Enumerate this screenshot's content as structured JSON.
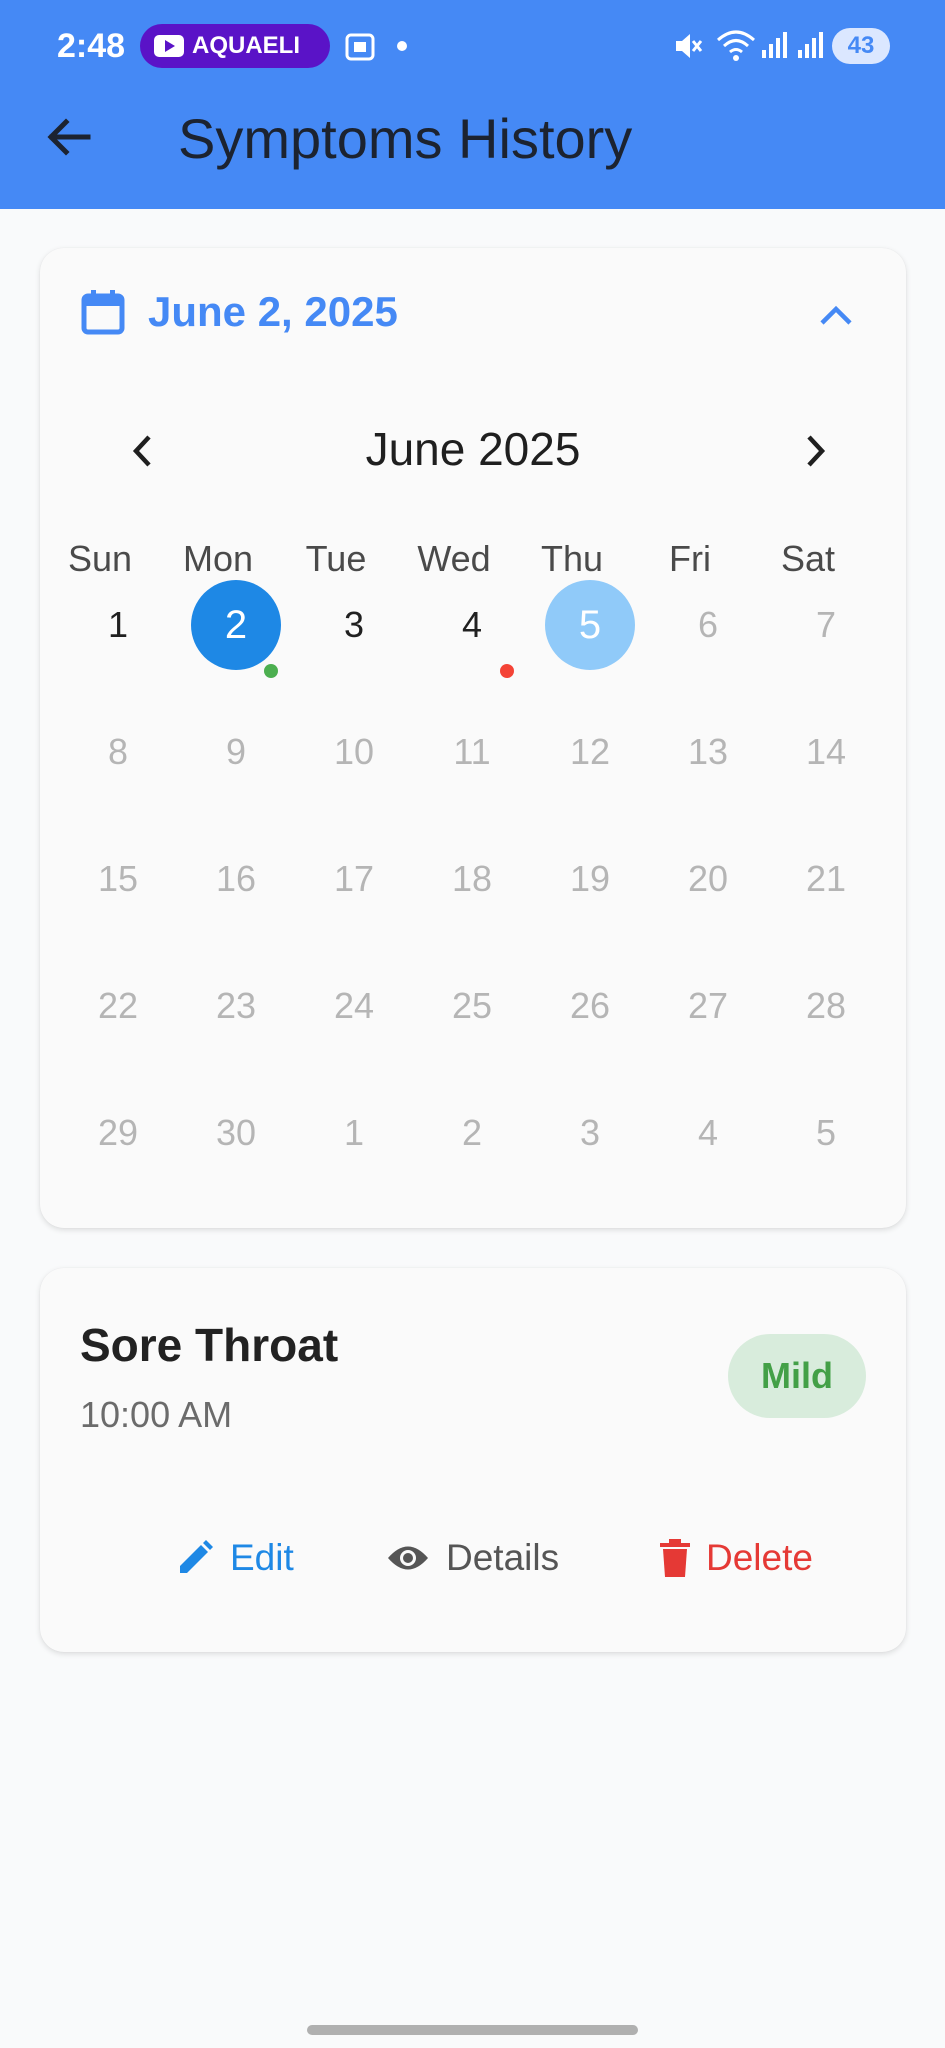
{
  "status_bar": {
    "time": "2:48",
    "media_app": "AQUAELI",
    "battery": "43"
  },
  "header": {
    "title": "Symptoms History"
  },
  "calendar": {
    "selected_date_label": "June 2, 2025",
    "month_label": "June 2025",
    "weekdays": [
      "Sun",
      "Mon",
      "Tue",
      "Wed",
      "Thu",
      "Fri",
      "Sat"
    ],
    "weeks": [
      [
        "1",
        "2",
        "3",
        "4",
        "5",
        "6",
        "7"
      ],
      [
        "8",
        "9",
        "10",
        "11",
        "12",
        "13",
        "14"
      ],
      [
        "15",
        "16",
        "17",
        "18",
        "19",
        "20",
        "21"
      ],
      [
        "22",
        "23",
        "24",
        "25",
        "26",
        "27",
        "28"
      ],
      [
        "29",
        "30",
        "1",
        "2",
        "3",
        "4",
        "5"
      ]
    ],
    "selected_day": "2",
    "today": "5",
    "markers": [
      {
        "day": "2",
        "color": "#4caf50"
      },
      {
        "day": "4",
        "color": "#f44336"
      }
    ]
  },
  "symptom": {
    "name": "Sore Throat",
    "time": "10:00 AM",
    "severity": "Mild",
    "actions": {
      "edit": "Edit",
      "details": "Details",
      "delete": "Delete"
    }
  },
  "colors": {
    "primary": "#4589f5",
    "selected": "#1e88e5",
    "today": "#90caf9",
    "mild": "#43a047",
    "delete": "#e53935"
  }
}
